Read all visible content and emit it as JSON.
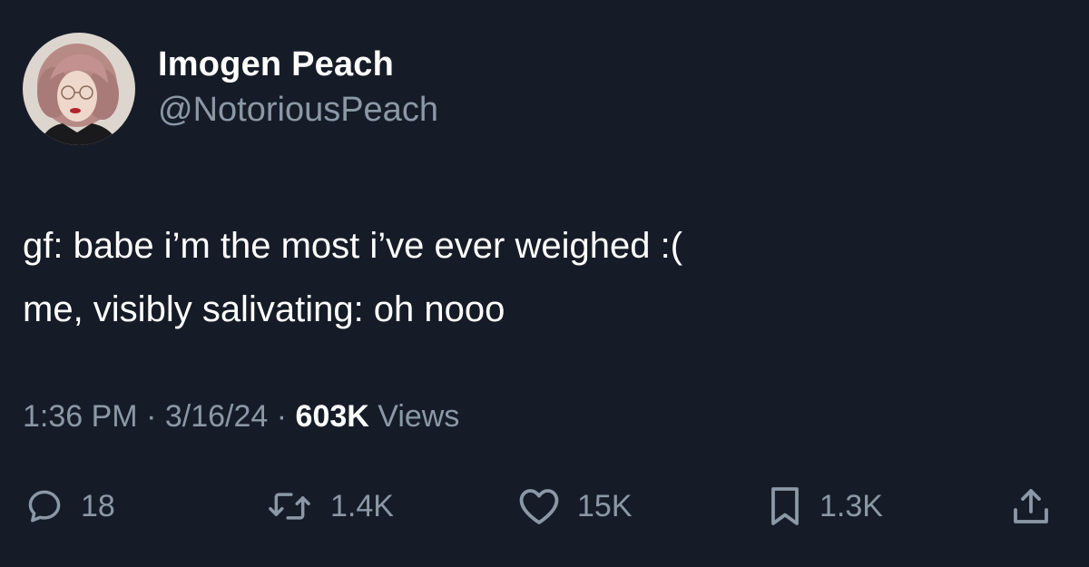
{
  "author": {
    "display_name": "Imogen Peach",
    "handle": "@NotoriousPeach"
  },
  "tweet": {
    "lines": [
      "gf: babe i’m the most i’ve ever weighed :(",
      "me, visibly salivating: oh nooo"
    ]
  },
  "meta": {
    "time": "1:36 PM",
    "date": "3/16/24",
    "separator": "·",
    "views_count": "603K",
    "views_label": "Views"
  },
  "actions": {
    "reply": {
      "icon": "reply-icon",
      "count": "18"
    },
    "retweet": {
      "icon": "retweet-icon",
      "count": "1.4K"
    },
    "like": {
      "icon": "heart-icon",
      "count": "15K"
    },
    "bookmark": {
      "icon": "bookmark-icon",
      "count": "1.3K"
    },
    "share": {
      "icon": "share-icon"
    }
  },
  "colors": {
    "background": "#161c27",
    "primary_text": "#ffffff",
    "secondary_text": "#8b98a5"
  }
}
